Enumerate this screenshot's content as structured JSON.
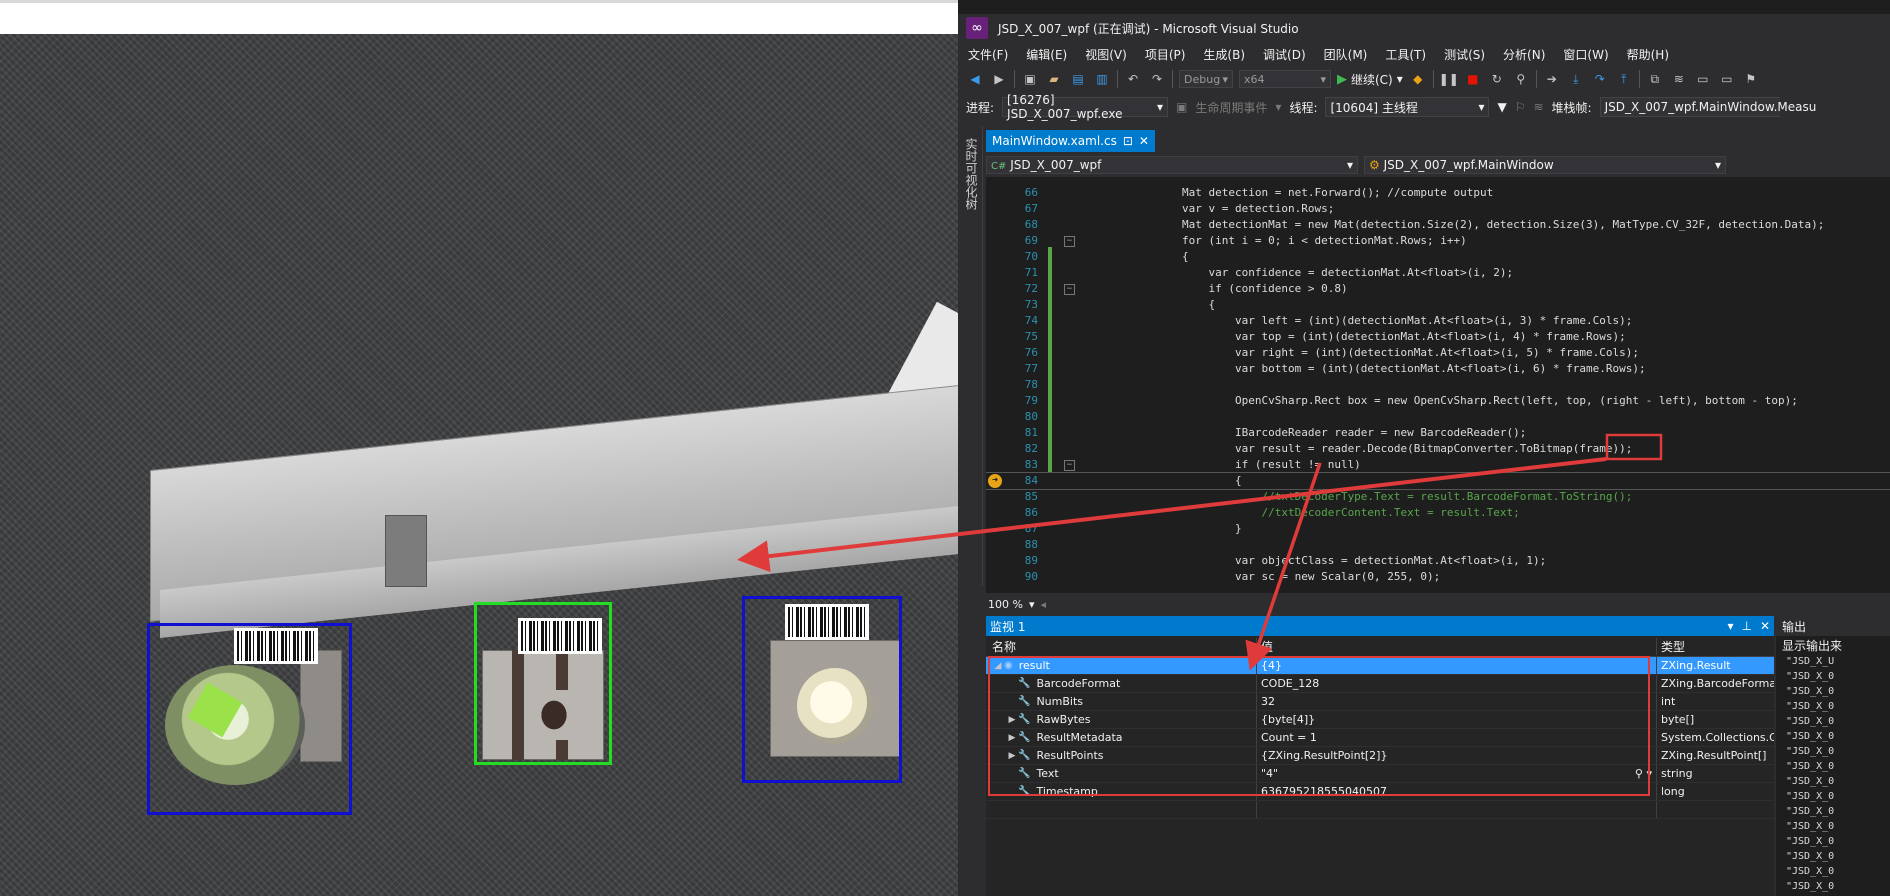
{
  "window": {
    "title": "JSD_X_007_wpf (正在调试) - Microsoft Visual Studio"
  },
  "menu": [
    "文件(F)",
    "编辑(E)",
    "视图(V)",
    "项目(P)",
    "生成(B)",
    "调试(D)",
    "团队(M)",
    "工具(T)",
    "测试(S)",
    "分析(N)",
    "窗口(W)",
    "帮助(H)"
  ],
  "toolbar": {
    "config": "Debug",
    "platform": "x64",
    "continue_label": "继续(C)"
  },
  "debugbar": {
    "process_label": "进程:",
    "process_value": "[16276] JSD_X_007_wpf.exe",
    "lifecycle_label": "生命周期事件",
    "thread_label": "线程:",
    "thread_value": "[10604] 主线程",
    "stackframe_label": "堆栈帧:",
    "stackframe_value": "JSD_X_007_wpf.MainWindow.Measu"
  },
  "side_tab": "实时可视化树",
  "doc_tab": {
    "label": "MainWindow.xaml.cs",
    "pin": "⊡",
    "close": "✕"
  },
  "nav": {
    "project": "JSD_X_007_wpf",
    "class": "JSD_X_007_wpf.MainWindow"
  },
  "code_lines": [
    {
      "n": "66",
      "text": "Mat detection = net.Forward(); //compute output"
    },
    {
      "n": "67",
      "text": "var v = detection.Rows;"
    },
    {
      "n": "68",
      "text": "Mat detectionMat = new Mat(detection.Size(2), detection.Size(3), MatType.CV_32F, detection.Data);"
    },
    {
      "n": "69",
      "text": "for (int i = 0; i < detectionMat.Rows; i++)"
    },
    {
      "n": "70",
      "text": "{"
    },
    {
      "n": "71",
      "text": "    var confidence = detectionMat.At<float>(i, 2);"
    },
    {
      "n": "72",
      "text": "    if (confidence > 0.8)"
    },
    {
      "n": "73",
      "text": "    {"
    },
    {
      "n": "74",
      "text": "        var left = (int)(detectionMat.At<float>(i, 3) * frame.Cols);"
    },
    {
      "n": "75",
      "text": "        var top = (int)(detectionMat.At<float>(i, 4) * frame.Rows);"
    },
    {
      "n": "76",
      "text": "        var right = (int)(detectionMat.At<float>(i, 5) * frame.Cols);"
    },
    {
      "n": "77",
      "text": "        var bottom = (int)(detectionMat.At<float>(i, 6) * frame.Rows);"
    },
    {
      "n": "78",
      "text": ""
    },
    {
      "n": "79",
      "text": "        OpenCvSharp.Rect box = new OpenCvSharp.Rect(left, top, (right - left), bottom - top);"
    },
    {
      "n": "80",
      "text": ""
    },
    {
      "n": "81",
      "text": "        IBarcodeReader reader = new BarcodeReader();"
    },
    {
      "n": "82",
      "text": "        var result = reader.Decode(BitmapConverter.ToBitmap(frame));"
    },
    {
      "n": "83",
      "text": "        if (result != null)"
    },
    {
      "n": "84",
      "text": "        {"
    },
    {
      "n": "85",
      "text": "            //txtDecoderType.Text = result.BarcodeFormat.ToString();"
    },
    {
      "n": "86",
      "text": "            //txtDecoderContent.Text = result.Text;"
    },
    {
      "n": "87",
      "text": "        }"
    },
    {
      "n": "88",
      "text": ""
    },
    {
      "n": "89",
      "text": "        var objectClass = detectionMat.At<float>(i, 1);"
    },
    {
      "n": "90",
      "text": "        var sc = new Scalar(0, 255, 0);"
    }
  ],
  "zoom": "100 %",
  "watch": {
    "title": "监视 1",
    "headers": {
      "name": "名称",
      "value": "值",
      "type": "类型"
    },
    "rows": [
      {
        "name": "result",
        "value": "{4}",
        "type": "ZXing.Result",
        "expand": "◢"
      },
      {
        "name": "BarcodeFormat",
        "value": "CODE_128",
        "type": "ZXing.BarcodeFormat",
        "expand": ""
      },
      {
        "name": "NumBits",
        "value": "32",
        "type": "int",
        "expand": ""
      },
      {
        "name": "RawBytes",
        "value": "{byte[4]}",
        "type": "byte[]",
        "expand": "▶"
      },
      {
        "name": "ResultMetadata",
        "value": "Count = 1",
        "type": "System.Collections.Ge...",
        "expand": "▶"
      },
      {
        "name": "ResultPoints",
        "value": "{ZXing.ResultPoint[2]}",
        "type": "ZXing.ResultPoint[]",
        "expand": "▶"
      },
      {
        "name": "Text",
        "value": "\"4\"",
        "type": "string",
        "expand": ""
      },
      {
        "name": "Timestamp",
        "value": "636795218555040507",
        "type": "long",
        "expand": ""
      }
    ]
  },
  "output": {
    "title": "输出",
    "source_label": "显示输出来",
    "lines": [
      "\"JSD_X_U",
      "\"JSD_X_0",
      "\"JSD_X_0",
      "\"JSD_X_0",
      "\"JSD_X_0",
      "\"JSD_X_0",
      "\"JSD_X_0",
      "\"JSD_X_0",
      "\"JSD_X_0",
      "\"JSD_X_0",
      "\"JSD_X_0",
      "\"JSD_X_0",
      "\"JSD_X_0",
      "\"JSD_X_0",
      "\"JSD_X_0",
      "\"JSD_X_0",
      "\"JSD_X_0"
    ]
  },
  "colors": {
    "accent": "#007acc",
    "annotation_red": "#e03b3b",
    "detect_blue": "#1010d0",
    "detect_green": "#22dd22"
  }
}
